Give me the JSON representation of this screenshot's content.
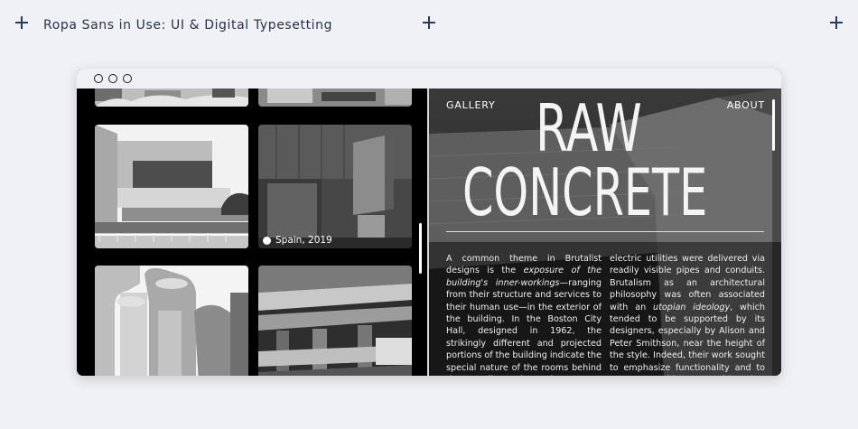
{
  "page": {
    "title": "Ropa Sans in Use: UI & Digital Typesetting"
  },
  "window": {
    "controls": [
      "window-dot",
      "window-dot",
      "window-dot"
    ]
  },
  "gallery": {
    "caption": "Spain, 2019",
    "tiles": [
      "building-photo",
      "building-photo",
      "building-photo",
      "building-photo",
      "building-photo",
      "building-photo"
    ]
  },
  "hero": {
    "nav_left": "GALLERY",
    "nav_right": "ABOUT",
    "headline_line1": "RAW",
    "headline_line2": "CONCRETE",
    "col1": [
      {
        "t": "A common theme in Brutalist designs is the ",
        "i": false
      },
      {
        "t": "exposure of the building's inner-workings",
        "i": true
      },
      {
        "t": "—ranging from their structure and services to their human use—in the exterior of the building. In the Boston City Hall, designed in 1962, the strikingly different and projected portions of the building indicate the special nature of the rooms behind those walls, such as the mayor's office or the city",
        "i": false
      }
    ],
    "col2": [
      {
        "t": "electric utilities were delivered via readily visible pipes and conduits. Brutalism as an architectural philosophy was often associated with an ",
        "i": false
      },
      {
        "t": "utopian ideology",
        "i": true
      },
      {
        "t": ", which tended to be supported by its designers, especially by Alison and Peter Smithson, near the height of the style. Indeed, their work sought to emphasize functionality and to connect architecture with what they viewed as the re",
        "i": false
      }
    ]
  },
  "colors": {
    "background": "#eff1f4",
    "title_text": "#24324c",
    "window_bg": "#000000",
    "hero_text": "#f4f4f4"
  }
}
